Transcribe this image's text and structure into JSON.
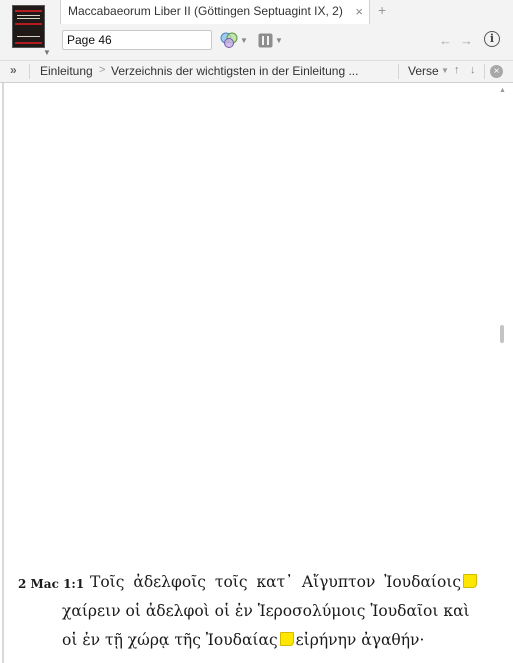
{
  "tab": {
    "title": "Maccabaeorum Liber II (Göttingen Septuagint IX, 2)",
    "close": "×",
    "new_tab": "+"
  },
  "toolbar": {
    "page_value": "Page 46",
    "icons": [
      "cover-thumbnail",
      "visual-filter-icon",
      "parallel-icon",
      "back-arrow-icon",
      "forward-arrow-icon",
      "info-icon"
    ],
    "back": "←",
    "forward": "→",
    "info": "i"
  },
  "navbar": {
    "more": "»",
    "crumbs": [
      "Einleitung",
      "Verzeichnis der wichtigsten in der Einleitung ..."
    ],
    "crumb_sep": ">",
    "verse_label": "Verse",
    "up": "↑",
    "down": "↓",
    "close": "×"
  },
  "content": {
    "verse_ref": "2 Mac 1:1",
    "line1": "Τοῖς ἀδελφοῖς τοῖς κατ᾽ Αἴγυπτον Ἰουδαίοις",
    "line2": "χαίρειν οἱ ἀδελφοὶ οἱ ἐν Ἱεροσολύμοις Ἰουδαῖοι καὶ",
    "line3a": "οἱ ἐν τῇ χώρᾳ τῆς Ἰουδαίας",
    "line3b": "εἰρήνην ἀγαθήν·",
    "note_color": "#ffe600"
  }
}
